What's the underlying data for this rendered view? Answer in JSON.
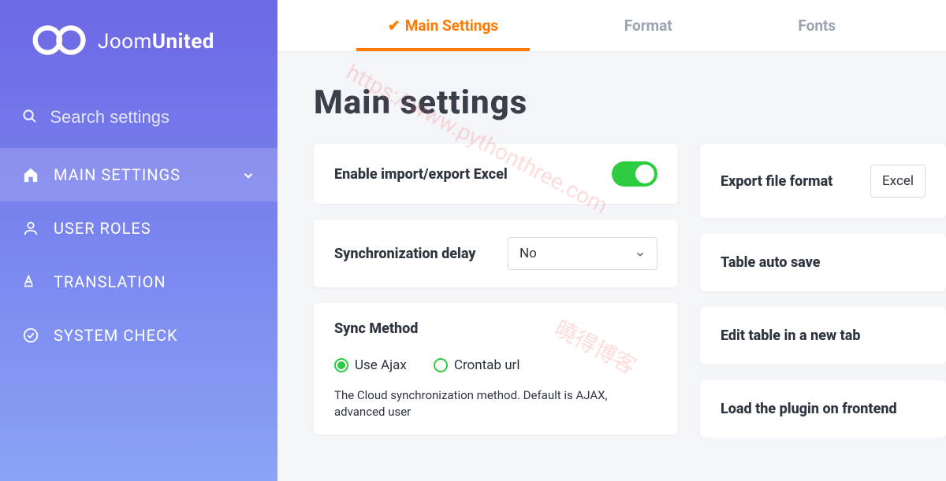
{
  "logo": {
    "brand_a": "Joom",
    "brand_b": "United"
  },
  "search": {
    "placeholder": "Search settings"
  },
  "sidebar": {
    "items": [
      {
        "label": "MAIN SETTINGS"
      },
      {
        "label": "USER ROLES"
      },
      {
        "label": "TRANSLATION"
      },
      {
        "label": "SYSTEM CHECK"
      }
    ]
  },
  "tabs": [
    {
      "label": "Main Settings"
    },
    {
      "label": "Format"
    },
    {
      "label": "Fonts"
    }
  ],
  "page": {
    "title": "Main settings"
  },
  "settings": {
    "enable_import_export": {
      "label": "Enable import/export Excel",
      "value": true
    },
    "sync_delay": {
      "label": "Synchronization delay",
      "value": "No"
    },
    "sync_method": {
      "label": "Sync Method",
      "options": [
        "Use Ajax",
        "Crontab url"
      ],
      "selected": "Use Ajax",
      "description": "The Cloud synchronization method. Default is AJAX, advanced user"
    },
    "export_format": {
      "label": "Export file format",
      "value": "Excel"
    },
    "table_autosave": {
      "label": "Table auto save"
    },
    "edit_new_tab": {
      "label": "Edit table in a new tab"
    },
    "load_frontend": {
      "label": "Load the plugin on frontend"
    }
  },
  "watermarks": [
    "https://www.pythonthree.com",
    "曉得博客"
  ]
}
